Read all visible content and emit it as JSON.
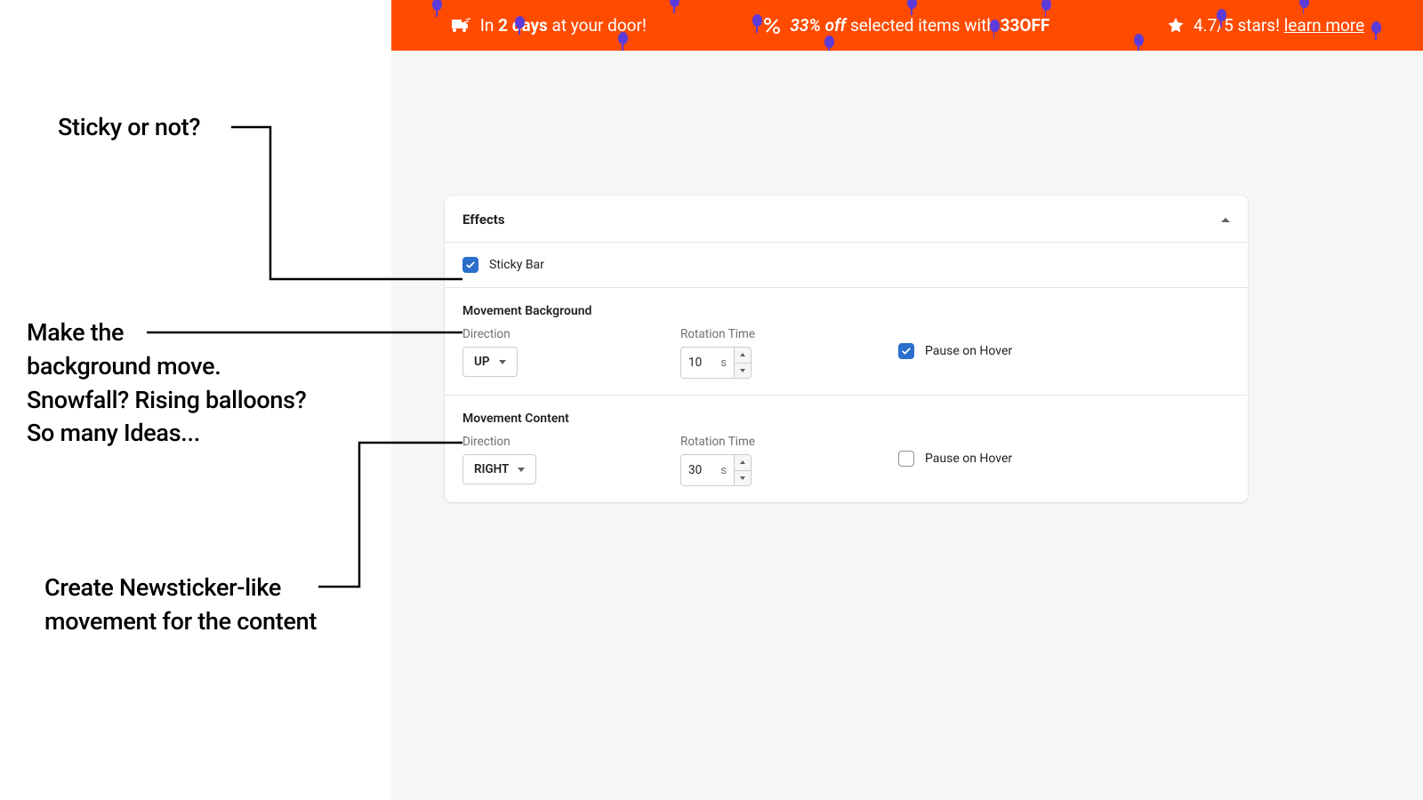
{
  "annotations": {
    "sticky": "Sticky or not?",
    "background": "Make the\nbackground move.\nSnowfall? Rising balloons?\nSo many Ideas...",
    "content": "Create Newsticker-like\nmovement for the content"
  },
  "preview_bar": {
    "shipping_prefix": "In ",
    "shipping_bold": "2 days",
    "shipping_suffix": " at your door!",
    "discount_em": "33% off",
    "discount_mid": " selected items with ",
    "discount_code": "33OFF",
    "stars_text": "4.7/5 stars! ",
    "stars_link": "learn more"
  },
  "effects": {
    "title": "Effects",
    "sticky": {
      "label": "Sticky Bar",
      "checked": true
    },
    "background": {
      "heading": "Movement Background",
      "direction_label": "Direction",
      "direction_value": "UP",
      "rotation_label": "Rotation Time",
      "rotation_value": "10",
      "rotation_unit": "s",
      "pause_label": "Pause on Hover",
      "pause_checked": true
    },
    "content": {
      "heading": "Movement Content",
      "direction_label": "Direction",
      "direction_value": "RIGHT",
      "rotation_label": "Rotation Time",
      "rotation_value": "30",
      "rotation_unit": "s",
      "pause_label": "Pause on Hover",
      "pause_checked": false
    }
  }
}
